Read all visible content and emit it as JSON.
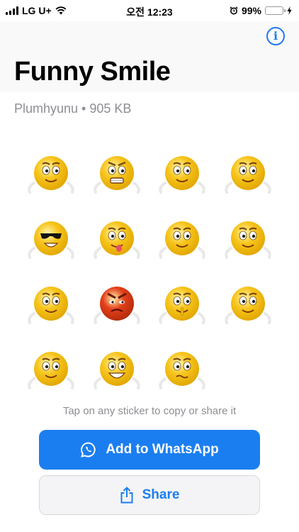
{
  "status_bar": {
    "carrier": "LG U+",
    "time": "오전 12:23",
    "battery": "99%",
    "battery_level": 0.99
  },
  "pack": {
    "title": "Funny Smile",
    "publisher": "Plumhyunu",
    "size": "905 KB",
    "subtitle": "Plumhyunu • 905 KB"
  },
  "stickers": [
    {
      "name": "smirk-grin-sticker",
      "color": "#f7c51c"
    },
    {
      "name": "grimace-sticker",
      "color": "#f7c51c"
    },
    {
      "name": "thinking-sticker",
      "color": "#f7c51c"
    },
    {
      "name": "shrug-sticker",
      "color": "#f7c51c"
    },
    {
      "name": "cool-sunglasses-sticker",
      "color": "#f7c51c"
    },
    {
      "name": "tongue-out-sticker",
      "color": "#f7c51c"
    },
    {
      "name": "hand-over-mouth-sticker",
      "color": "#f7c51c"
    },
    {
      "name": "eye-roll-sticker",
      "color": "#f7c51c"
    },
    {
      "name": "open-arms-sticker",
      "color": "#f7c51c"
    },
    {
      "name": "angry-red-sticker",
      "color": "#e3401b"
    },
    {
      "name": "shush-sticker",
      "color": "#f7c51c"
    },
    {
      "name": "wink-point-sticker",
      "color": "#f7c51c"
    },
    {
      "name": "idea-full-body-sticker",
      "color": "#f7c51c"
    },
    {
      "name": "big-smile-sticker",
      "color": "#f7c51c"
    },
    {
      "name": "nervous-sticker",
      "color": "#f7c51c"
    }
  ],
  "hint": "Tap on any sticker to copy or share it",
  "buttons": {
    "whatsapp": "Add to WhatsApp",
    "share": "Share"
  },
  "colors": {
    "accent": "#1b7ef0",
    "secondary_text": "#8e8e93",
    "emoji_yellow": "#f7c51c",
    "emoji_red": "#e3401b"
  }
}
